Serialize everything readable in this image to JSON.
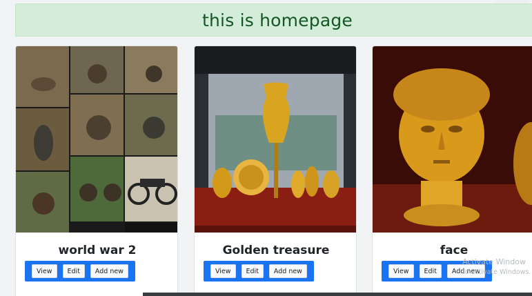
{
  "header": {
    "title": "this is homepage"
  },
  "cards": [
    {
      "title": "world war 2",
      "image": "ww2-motorcycle-collage",
      "buttons": {
        "view": "View",
        "edit": "Edit",
        "add": "Add new"
      }
    },
    {
      "title": "Golden treasure",
      "image": "golden-treasure-display",
      "buttons": {
        "view": "View",
        "edit": "Edit",
        "add": "Add new"
      }
    },
    {
      "title": "face",
      "image": "golden-face-vessel",
      "buttons": {
        "view": "View",
        "edit": "Edit",
        "add": "Add new"
      }
    }
  ],
  "overlay": {
    "line1": "Activate Window",
    "line2": "to activate Windows."
  },
  "colors": {
    "banner_bg": "#d4edda",
    "banner_text": "#155724",
    "button_group": "#1a73f0"
  }
}
